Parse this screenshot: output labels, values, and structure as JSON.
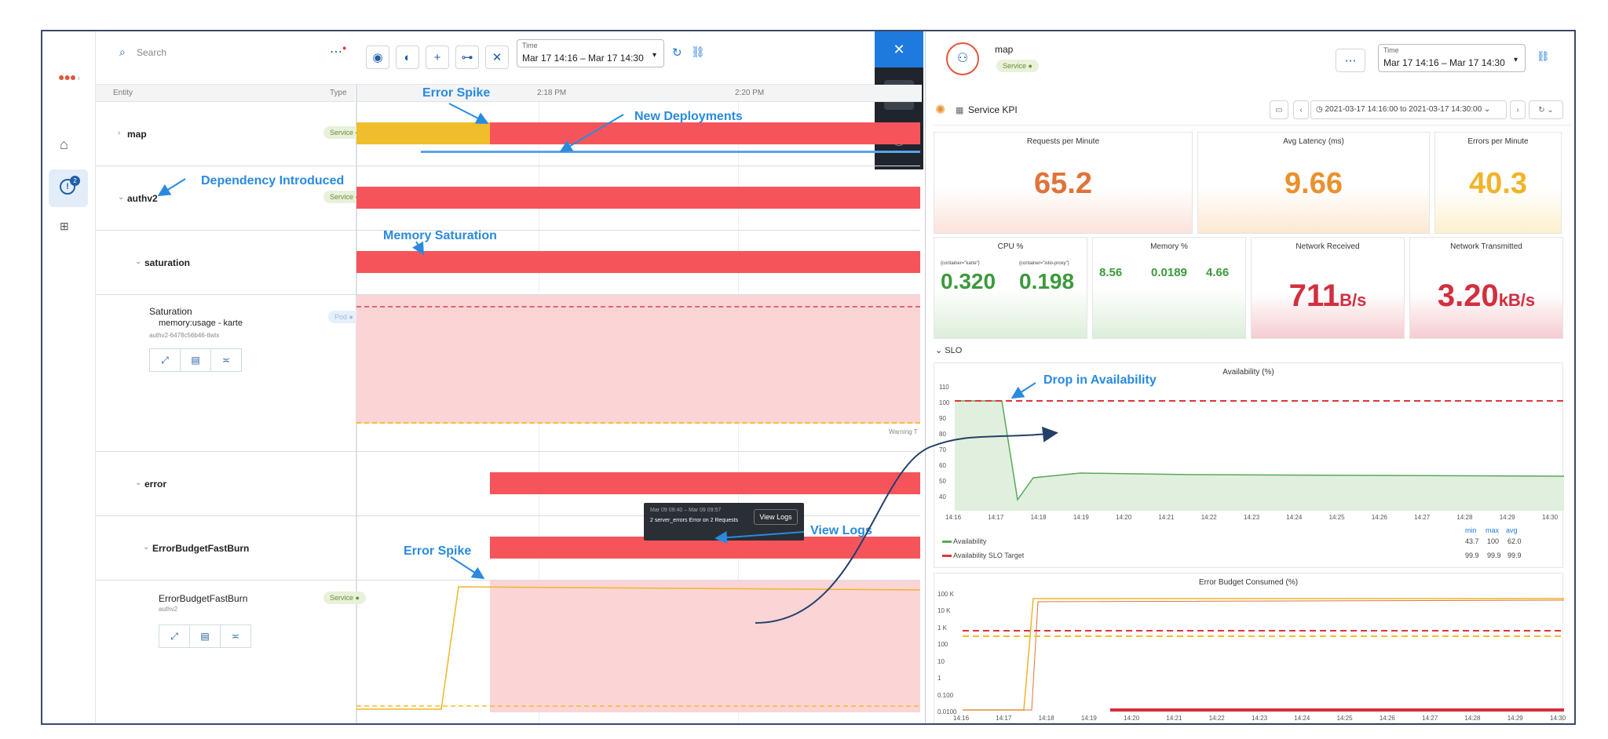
{
  "toolbar": {
    "search_placeholder": "Search",
    "time_label": "Time",
    "time_value": "Mar 17 14:16 – Mar 17 14:30"
  },
  "rail": {
    "notification_count": "2"
  },
  "entity_table": {
    "col_entity": "Entity",
    "col_type": "Type",
    "time_ticks": [
      "2:18 PM",
      "2:20 PM"
    ],
    "rows": {
      "map": {
        "name": "map",
        "type": "Service"
      },
      "authv2": {
        "name": "authv2",
        "type": "Service"
      },
      "saturation": {
        "name": "saturation"
      },
      "saturation_detail": {
        "title": "Saturation",
        "metric": "memory:usage - karte",
        "pod": "authv2-6478c56b46-tlwtx",
        "type": "Pod"
      },
      "error": {
        "name": "error"
      },
      "ebfb": {
        "name": "ErrorBudgetFastBurn"
      },
      "ebfb_detail": {
        "title": "ErrorBudgetFastBurn",
        "sub": "authv2",
        "type": "Service"
      }
    },
    "warning_label": "Warning T"
  },
  "tooltip": {
    "time": "Mar 09 09:40 – Mar 09 09:57",
    "text": "2 server_errors Error on 2 Requests",
    "button": "View Logs"
  },
  "annotations": {
    "error_spike_top": "Error Spike",
    "new_deployments": "New Deployments",
    "dependency_introduced": "Dependency Introduced",
    "memory_saturation": "Memory Saturation",
    "error_spike_bottom": "Error Spike",
    "view_logs": "View Logs",
    "drop_availability": "Drop in Availability"
  },
  "panel": {
    "entity_name": "map",
    "entity_type": "Service",
    "time_label": "Time",
    "time_value": "Mar 17 14:16 – Mar 17 14:30",
    "dashboard_title": "Service KPI",
    "dashboard_range": "2021-03-17 14:16:00 to 2021-03-17 14:30:00",
    "stats": {
      "rpm": {
        "title": "Requests per Minute",
        "value": "65.2",
        "color": "#e0733a"
      },
      "latency": {
        "title": "Avg Latency (ms)",
        "value": "9.66",
        "color": "#e8912d"
      },
      "epm": {
        "title": "Errors per Minute",
        "value": "40.3",
        "color": "#f0b429"
      },
      "cpu": {
        "title": "CPU %",
        "a_label": "{container=\"karte\"}",
        "a_value": "0.320",
        "b_label": "{container=\"istio-proxy\"}",
        "b_value": "0.198",
        "color": "#3c9a3c"
      },
      "mem": {
        "title": "Memory %",
        "v1": "8.56",
        "v2": "0.0189",
        "v3": "4.66",
        "color": "#3c9a3c"
      },
      "net_rx": {
        "title": "Network Received",
        "value": "711",
        "unit": "B/s",
        "color": "#d32f3f"
      },
      "net_tx": {
        "title": "Network Transmitted",
        "value": "3.20",
        "unit": "kB/s",
        "color": "#d32f3f"
      }
    },
    "slo_section": "SLO",
    "availability": {
      "title": "Availability (%)",
      "y_ticks": [
        "110",
        "100",
        "90",
        "80",
        "70",
        "60",
        "50",
        "40"
      ],
      "x_ticks": [
        "14:16",
        "14:17",
        "14:18",
        "14:19",
        "14:20",
        "14:21",
        "14:22",
        "14:23",
        "14:24",
        "14:25",
        "14:26",
        "14:27",
        "14:28",
        "14:29",
        "14:30"
      ],
      "legend_header": [
        "min",
        "max",
        "avg"
      ],
      "legend": [
        {
          "name": "Availability",
          "color": "#5aa857",
          "min": "43.7",
          "max": "100",
          "avg": "62.0"
        },
        {
          "name": "Availability SLO Target",
          "color": "#e0343c",
          "min": "99.9",
          "max": "99.9",
          "avg": "99.9"
        }
      ]
    },
    "error_budget": {
      "title": "Error Budget Consumed (%)",
      "y_ticks": [
        "100 K",
        "10 K",
        "1 K",
        "100",
        "10",
        "1",
        "0.100",
        "0.0100"
      ],
      "x_ticks": [
        "14:16",
        "14:17",
        "14:18",
        "14:19",
        "14:20",
        "14:21",
        "14:22",
        "14:23",
        "14:24",
        "14:25",
        "14:26",
        "14:27",
        "14:28",
        "14:29",
        "14:30"
      ]
    }
  },
  "colors": {
    "accent": "#1f7ae0",
    "red": "#f6545b",
    "yellow": "#f0be2c",
    "anno": "#2a8ae0"
  }
}
